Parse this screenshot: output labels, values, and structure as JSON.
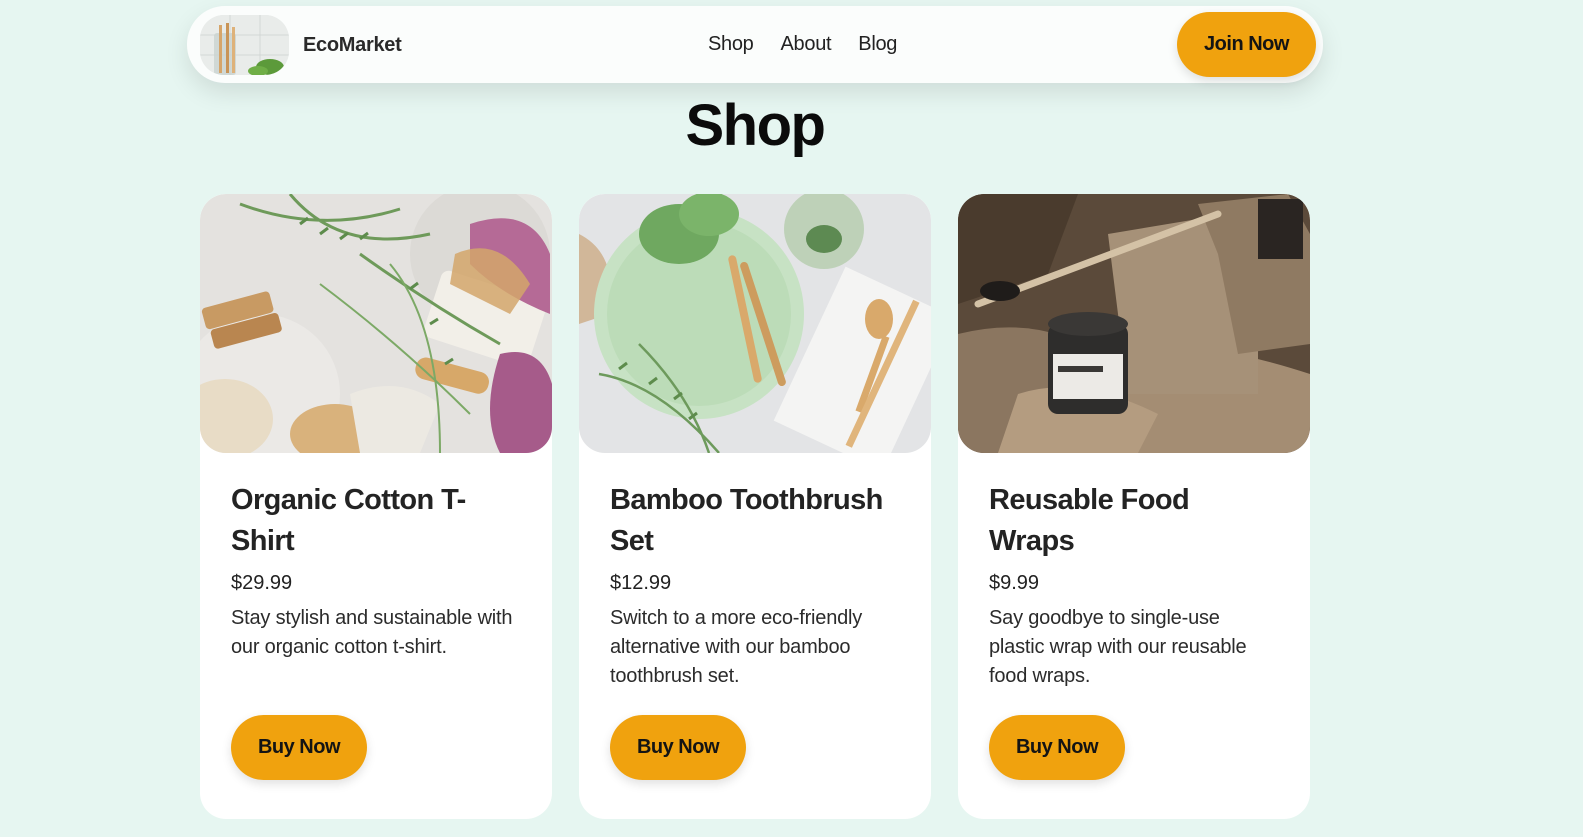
{
  "nav": {
    "brand": "EcoMarket",
    "links": [
      "Shop",
      "About",
      "Blog"
    ],
    "join_label": "Join Now"
  },
  "page_title": "Shop",
  "products": [
    {
      "title": "Organic Cotton T-Shirt",
      "price": "$29.99",
      "description": "Stay stylish and sustainable with our organic cotton t-shirt.",
      "button": "Buy Now"
    },
    {
      "title": "Bamboo Toothbrush Set",
      "price": "$12.99",
      "description": "Switch to a more eco-friendly alternative with our bamboo toothbrush set.",
      "button": "Buy Now"
    },
    {
      "title": "Reusable Food Wraps",
      "price": "$9.99",
      "description": "Say goodbye to single-use plastic wrap with our reusable food wraps.",
      "button": "Buy Now"
    }
  ],
  "colors": {
    "background": "#e6f6f1",
    "accent": "#f0a20e",
    "card": "#ffffff"
  }
}
